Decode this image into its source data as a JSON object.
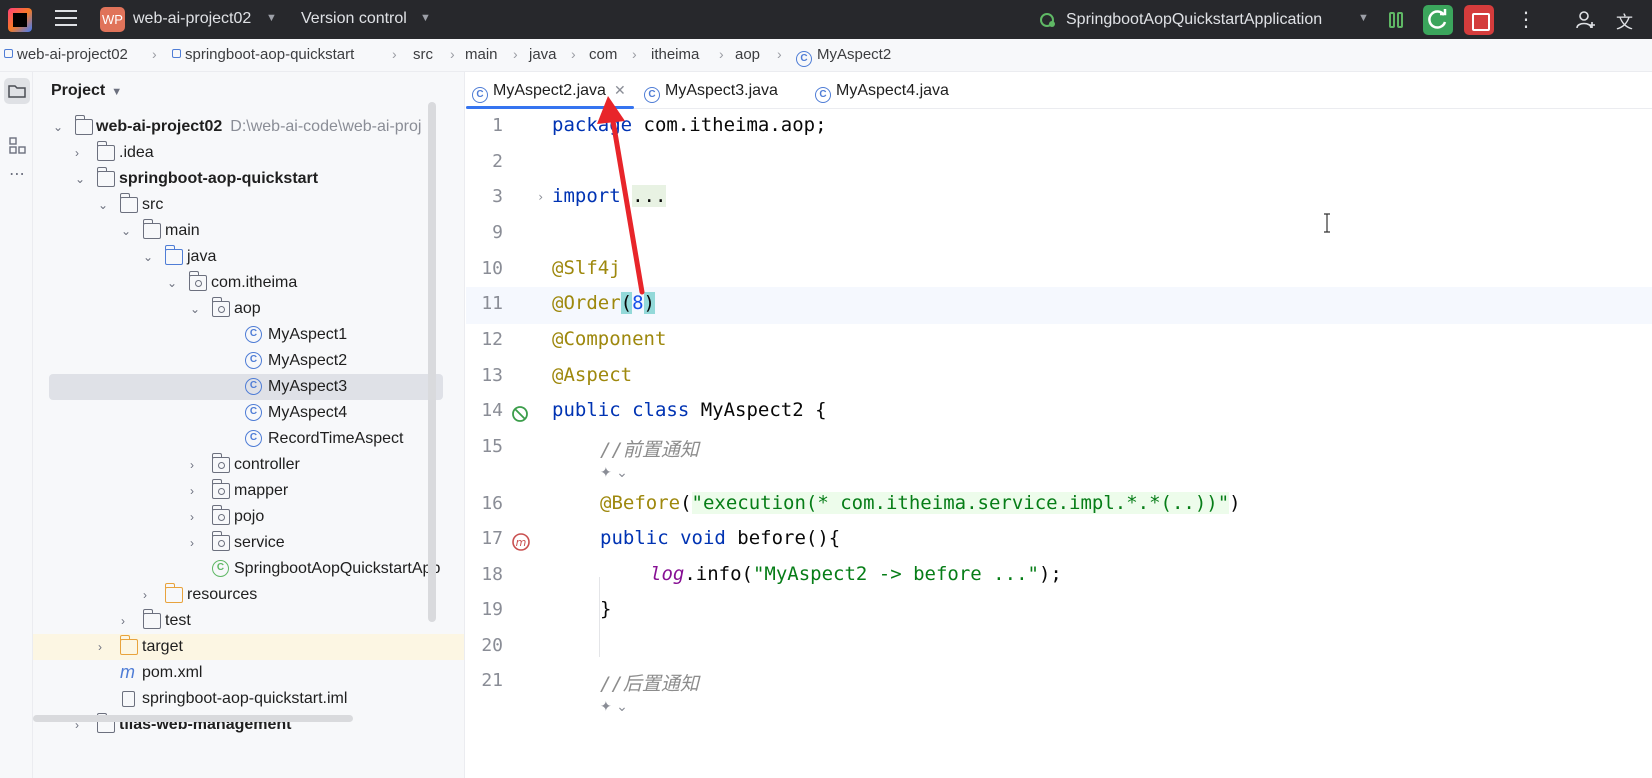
{
  "titlebar": {
    "project_badge": "WP",
    "project_name": "web-ai-project02",
    "version_control": "Version control",
    "run_config": "SpringbootAopQuickstartApplication"
  },
  "breadcrumb": [
    "web-ai-project02",
    "springboot-aop-quickstart",
    "src",
    "main",
    "java",
    "com",
    "itheima",
    "aop",
    "MyAspect2"
  ],
  "project_panel": {
    "title": "Project",
    "tree": [
      {
        "label": "web-ai-project02",
        "path": "D:\\web-ai-code\\web-ai-proj"
      },
      {
        "label": ".idea"
      },
      {
        "label": "springboot-aop-quickstart"
      },
      {
        "label": "src"
      },
      {
        "label": "main"
      },
      {
        "label": "java"
      },
      {
        "label": "com.itheima"
      },
      {
        "label": "aop"
      },
      {
        "label": "MyAspect1"
      },
      {
        "label": "MyAspect2"
      },
      {
        "label": "MyAspect3"
      },
      {
        "label": "MyAspect4"
      },
      {
        "label": "RecordTimeAspect"
      },
      {
        "label": "controller"
      },
      {
        "label": "mapper"
      },
      {
        "label": "pojo"
      },
      {
        "label": "service"
      },
      {
        "label": "SpringbootAopQuickstartApp"
      },
      {
        "label": "resources"
      },
      {
        "label": "test"
      },
      {
        "label": "target"
      },
      {
        "label": "pom.xml"
      },
      {
        "label": "springboot-aop-quickstart.iml"
      },
      {
        "label": "tlias-web-management"
      }
    ]
  },
  "tabs": [
    {
      "label": "MyAspect2.java",
      "active": true
    },
    {
      "label": "MyAspect3.java"
    },
    {
      "label": "MyAspect4.java"
    }
  ],
  "editor": {
    "line_numbers": [
      "1",
      "2",
      "3",
      "9",
      "10",
      "11",
      "12",
      "13",
      "14",
      "15",
      "16",
      "17",
      "18",
      "19",
      "20",
      "21"
    ],
    "lines": {
      "l1_kw": "package",
      "l1_rest": " com.itheima.aop;",
      "l3_kw": "import",
      "l3_fold": "...",
      "l10": "@Slf4j",
      "l11_ann": "@Order",
      "l11_open": "(",
      "l11_num": "8",
      "l11_close": ")",
      "l12": "@Component",
      "l13": "@Aspect",
      "l14_kw": "public class",
      "l14_rest": " MyAspect2 {",
      "l15": "//前置通知",
      "l16_ann": "@Before",
      "l16_open": "(",
      "l16_str": "\"execution(* com.itheima.service.impl.*.*(..))\"",
      "l16_close": ")",
      "l17_kw": "public void",
      "l17_rest": " before(){",
      "l18_log": "log",
      "l18_mid": ".info(",
      "l18_str": "\"MyAspect2 -> before ...\"",
      "l18_end": ");",
      "l19": "}",
      "l21": "//后置通知"
    }
  },
  "colors": {
    "accent": "#3574f0",
    "annotation_arrow": "#e8252a",
    "run_green": "#3ba55c",
    "stop_red": "#d43c3c"
  }
}
